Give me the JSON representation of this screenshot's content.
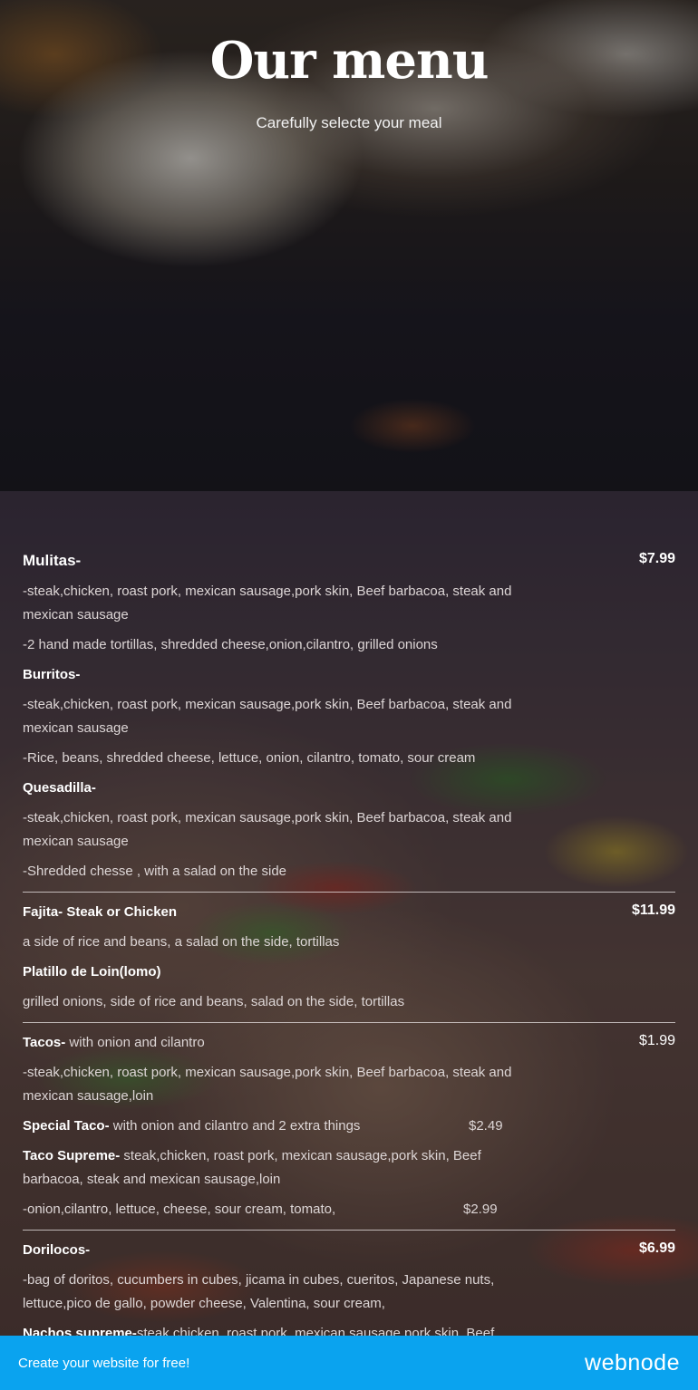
{
  "hero": {
    "title": "Our menu",
    "subtitle": "Carefully selecte your meal"
  },
  "menu": {
    "mulitas": {
      "name": "Mulitas-",
      "price": "$7.99",
      "line1": "-steak,chicken, roast pork, mexican sausage,pork skin, Beef barbacoa, steak and mexican sausage",
      "line2": "-2 hand made tortillas, shredded cheese,onion,cilantro, grilled onions"
    },
    "burritos": {
      "name": "Burritos-",
      "line1": "-steak,chicken, roast pork, mexican sausage,pork skin, Beef barbacoa, steak and mexican sausage",
      "line2": "-Rice, beans, shredded cheese, lettuce, onion, cilantro, tomato, sour cream"
    },
    "quesadilla": {
      "name": "Quesadilla-",
      "line1": "-steak,chicken, roast pork, mexican sausage,pork skin, Beef barbacoa, steak and mexican sausage",
      "line2": "-Shredded chesse , with a salad on the side"
    },
    "fajita": {
      "name": "Fajita- Steak or Chicken",
      "price": "$11.99",
      "line1": "a side of rice and beans, a salad on the side, tortillas"
    },
    "platillo": {
      "name": "Platillo de Loin(lomo)",
      "line1": "grilled onions, side of rice and beans, salad on the side, tortillas"
    },
    "tacos": {
      "name": "Tacos-",
      "desc": " with onion and cilantro",
      "price": "$1.99",
      "line1": "-steak,chicken, roast pork, mexican sausage,pork skin, Beef barbacoa, steak and mexican sausage,loin"
    },
    "special_taco": {
      "name": "Special Taco-",
      "desc": " with onion and cilantro and 2 extra things",
      "price": "$2.49"
    },
    "taco_supreme": {
      "name": "Taco Supreme-",
      "desc": " steak,chicken, roast pork, mexican sausage,pork skin, Beef  barbacoa, steak and mexican sausage,loin",
      "line1": "-onion,cilantro, lettuce, cheese, sour cream, tomato,",
      "price": "$2.99"
    },
    "dorilocos": {
      "name": "Dorilocos-",
      "price": "$6.99",
      "line1": "-bag of doritos, cucumbers in cubes, jicama in cubes, cueritos, Japanese nuts, lettuce,pico de gallo, powder cheese, Valentina, sour cream,"
    },
    "nachos": {
      "name": "Nachos supreme-",
      "desc": "steak,chicken, roast pork, mexican sausage,pork skin, Beef"
    }
  },
  "banner": {
    "text": "Create your website for free!",
    "logo": "webnode"
  }
}
